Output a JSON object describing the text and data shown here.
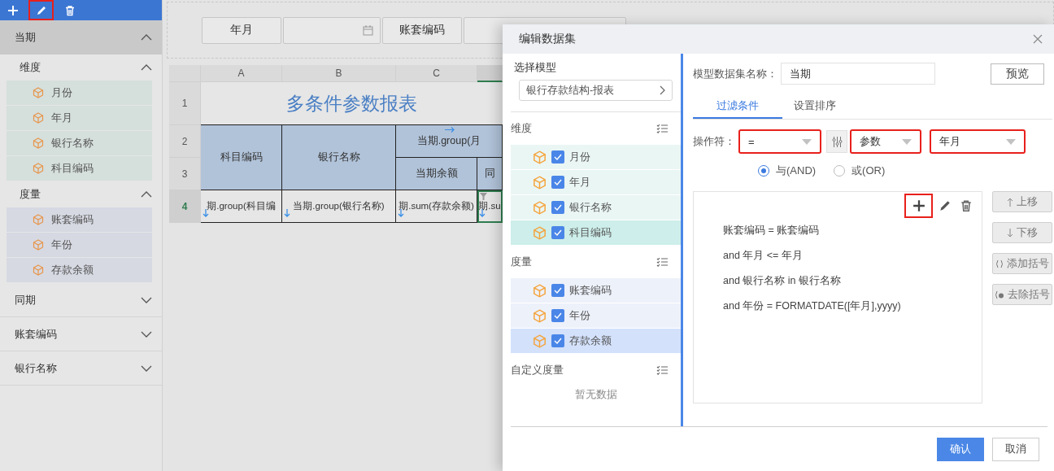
{
  "sidebar": {
    "toolbar": [
      {
        "kind": "add",
        "highlighted": false
      },
      {
        "kind": "edit",
        "highlighted": true
      },
      {
        "kind": "delete",
        "highlighted": false
      }
    ],
    "groups": [
      {
        "title": "当期",
        "expanded": true,
        "sections": [
          {
            "title": "维度",
            "kind": "dimension",
            "expanded": true,
            "items": [
              "月份",
              "年月",
              "银行名称",
              "科目编码"
            ]
          },
          {
            "title": "度量",
            "kind": "measure",
            "expanded": true,
            "items": [
              "账套编码",
              "年份",
              "存款余额"
            ]
          }
        ]
      },
      {
        "title": "同期",
        "expanded": false
      },
      {
        "title": "账套编码",
        "expanded": false
      },
      {
        "title": "银行名称",
        "expanded": false
      }
    ]
  },
  "parameter_panel": {
    "items": [
      {
        "kind": "label",
        "text": "年月"
      },
      {
        "kind": "date"
      },
      {
        "kind": "label",
        "text": "账套编码"
      },
      {
        "kind": "field"
      }
    ]
  },
  "sheet": {
    "column_headers": [
      {
        "label": "A",
        "selected": false
      },
      {
        "label": "B",
        "selected": false
      },
      {
        "label": "C",
        "selected": false
      },
      {
        "selected": true
      }
    ],
    "row_headers": [
      {
        "label": "1",
        "selected": false
      },
      {
        "label": "2",
        "selected": false
      },
      {
        "label": "3",
        "selected": false
      },
      {
        "label": "4",
        "selected": true
      }
    ],
    "title": "多条件参数报表",
    "header_cells": [
      {
        "text": "科目编码"
      },
      {
        "text": "银行名称"
      },
      {
        "text": "当期.group(月",
        "expands_right": true
      },
      {
        "text": "当期余额"
      },
      {
        "text": "同"
      }
    ],
    "data_cells": [
      {
        "text": "期.group(科目编",
        "expands_down": true,
        "filter": false,
        "selected": false
      },
      {
        "text": "当期.group(银行名称)",
        "expands_down": true,
        "filter": false,
        "selected": false
      },
      {
        "text": "期.sum(存款余额)",
        "expands_down": true,
        "filter": false,
        "selected": false
      },
      {
        "text": "期.su",
        "expands_down": true,
        "filter": true,
        "selected": true
      }
    ]
  },
  "dialog": {
    "title": "编辑数据集",
    "model_label": "选择模型",
    "model": "银行存款结构-报表",
    "field_groups": [
      {
        "title": "维度",
        "kind": "dimension",
        "items": [
          {
            "label": "月份",
            "checked": true,
            "selected": false
          },
          {
            "label": "年月",
            "checked": true,
            "selected": false
          },
          {
            "label": "银行名称",
            "checked": true,
            "selected": false
          },
          {
            "label": "科目编码",
            "checked": true,
            "selected": true
          }
        ]
      },
      {
        "title": "度量",
        "kind": "measure",
        "items": [
          {
            "label": "账套编码",
            "checked": true,
            "selected": false
          },
          {
            "label": "年份",
            "checked": true,
            "selected": false
          },
          {
            "label": "存款余额",
            "checked": true,
            "selected": true
          }
        ]
      },
      {
        "title": "自定义度量",
        "empty_text": "暂无数据"
      }
    ],
    "name_label": "模型数据集名称：",
    "name_value": "当期",
    "preview_button": "预览",
    "tabs": [
      {
        "label": "过滤条件",
        "selected": true
      },
      {
        "label": "设置排序",
        "selected": false
      }
    ],
    "operator_label": "操作符：",
    "operator": {
      "value": "=",
      "highlighted": true
    },
    "value_type": {
      "value": "参数",
      "highlighted": true
    },
    "value": {
      "value": "年月",
      "highlighted": true
    },
    "logic": [
      {
        "label": "与(AND)",
        "selected": true
      },
      {
        "label": "或(OR)",
        "selected": false
      }
    ],
    "condition_tools": [
      {
        "kind": "add",
        "highlighted": true
      },
      {
        "kind": "edit",
        "highlighted": false
      },
      {
        "kind": "delete",
        "highlighted": false
      }
    ],
    "conditions": [
      "账套编码 = 账套编码",
      "and 年月 <= 年月",
      "and 银行名称 in 银行名称",
      "and 年份 = FORMATDATE([年月],yyyy)"
    ],
    "side_buttons": [
      {
        "kind": "up",
        "label": "上移"
      },
      {
        "kind": "down",
        "label": "下移"
      },
      {
        "kind": "add-bracket",
        "label": "添加括号"
      },
      {
        "kind": "remove-bracket",
        "label": "去除括号"
      }
    ],
    "footer": [
      {
        "kind": "primary",
        "label": "确认"
      },
      {
        "kind": "default",
        "label": "取消"
      }
    ]
  }
}
